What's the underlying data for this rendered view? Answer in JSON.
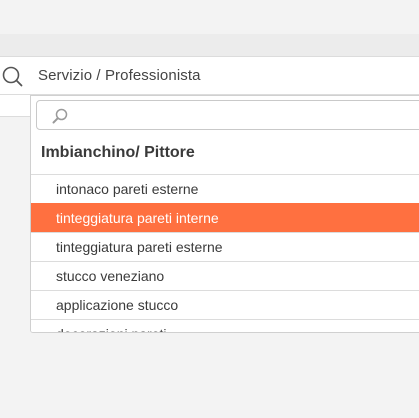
{
  "search": {
    "label": "Servizio / Professionista",
    "icon": "search-icon"
  },
  "dropdown": {
    "filter": {
      "icon": "search-icon",
      "value": "",
      "placeholder": ""
    },
    "group_label": "Imbianchino/ Pittore",
    "selected_index": 1,
    "options": [
      "intonaco pareti esterne",
      "tinteggiatura pareti interne",
      "tinteggiatura pareti esterne",
      "stucco veneziano",
      "applicazione stucco",
      "decorazioni pareti"
    ]
  },
  "colors": {
    "highlight": "#ff7040",
    "page_background": "#f3f3f3"
  }
}
